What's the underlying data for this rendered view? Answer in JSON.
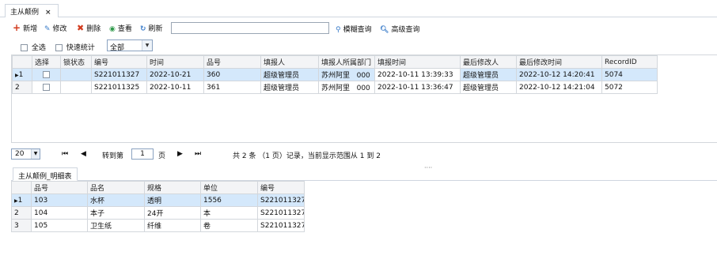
{
  "tab": {
    "title": "主从颠例",
    "close": "×"
  },
  "toolbar": {
    "add": "新增",
    "edit": "修改",
    "delete": "删除",
    "view": "查看",
    "refresh": "刷新",
    "search_value": "",
    "fuzzy": "模糊查询",
    "advanced": "高级查询"
  },
  "options": {
    "select_all": "全选",
    "quick_stats": "快速统计",
    "filter": "全部"
  },
  "colors": {
    "add": "#d23b1e",
    "delete": "#d23b1e",
    "accent": "#3a7cc9",
    "selected": "#d4e8fb"
  },
  "master": {
    "headers": [
      "选择",
      "锁状态",
      "编号",
      "时间",
      "品号",
      "填报人",
      "填报人所属部门",
      "填报时间",
      "最后修改人",
      "最后修改时间",
      "RecordID"
    ],
    "rows": [
      {
        "num": "1",
        "no": "S221011327",
        "time": "2022-10-21",
        "pn": "360",
        "reporter": "超级管理员",
        "dept": "苏州阿里",
        "dept_code": "000",
        "rtime": "2022-10-11 13:39:33",
        "modifier": "超级管理员",
        "mtime": "2022-10-12 14:20:41",
        "rid": "5074"
      },
      {
        "num": "2",
        "no": "S221011325",
        "time": "2022-10-11",
        "pn": "361",
        "reporter": "超级管理员",
        "dept": "苏州阿里",
        "dept_code": "000",
        "rtime": "2022-10-11 13:36:47",
        "modifier": "超级管理员",
        "mtime": "2022-10-12 14:21:04",
        "rid": "5072"
      }
    ]
  },
  "pager": {
    "page_size": "20",
    "goto_label": "转到第",
    "page_value": "1",
    "page_unit": "页",
    "summary": "共 2 条 （1 页）记录，当前显示范围从 1 到 2",
    "dots": "····"
  },
  "detail": {
    "tab": "主从颠例_明细表",
    "headers": [
      "品号",
      "品名",
      "规格",
      "单位",
      "编号"
    ],
    "rows": [
      {
        "num": "1",
        "pn": "103",
        "name": "水杯",
        "spec": "透明",
        "unit": "1556",
        "no": "S221011327"
      },
      {
        "num": "2",
        "pn": "104",
        "name": "本子",
        "spec": "24开",
        "unit": "本",
        "no": "S221011327"
      },
      {
        "num": "3",
        "pn": "105",
        "name": "卫生纸",
        "spec": "纤维",
        "unit": "卷",
        "no": "S221011327"
      }
    ]
  }
}
